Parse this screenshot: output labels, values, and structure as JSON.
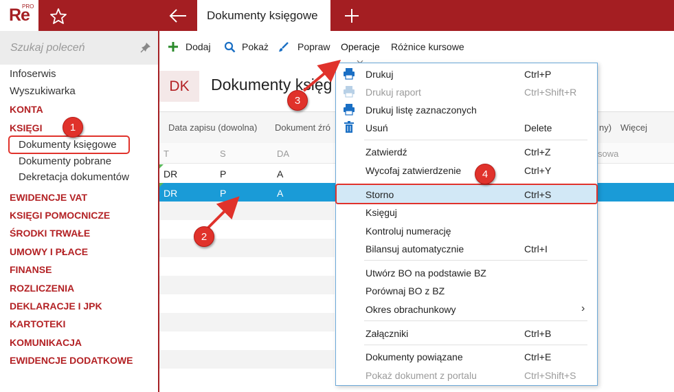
{
  "app": {
    "logo": "Re",
    "logo_sup": "PRO",
    "tab_title": "Dokumenty księgowe"
  },
  "sidebar": {
    "search_placeholder": "Szukaj poleceń",
    "items": [
      {
        "label": "Infoserwis"
      },
      {
        "label": "Wyszukiwarka"
      },
      {
        "label": "KONTA"
      },
      {
        "label": "KSIĘGI"
      },
      {
        "label": "Dokumenty księgowe"
      },
      {
        "label": "Dokumenty pobrane"
      },
      {
        "label": "Dekretacja dokumentów"
      },
      {
        "label": "EWIDENCJE VAT"
      },
      {
        "label": "KSIĘGI POMOCNICZE"
      },
      {
        "label": "ŚRODKI TRWAŁE"
      },
      {
        "label": "UMOWY I PŁACE"
      },
      {
        "label": "FINANSE"
      },
      {
        "label": "ROZLICZENIA"
      },
      {
        "label": "DEKLARACJE I JPK"
      },
      {
        "label": "KARTOTEKI"
      },
      {
        "label": "KOMUNIKACJA"
      },
      {
        "label": "EWIDENCJE DODATKOWE"
      }
    ]
  },
  "toolbar": {
    "add": "Dodaj",
    "show": "Pokaż",
    "edit": "Popraw",
    "operations": "Operacje",
    "rate_diff": "Różnice kursowe"
  },
  "view": {
    "badge": "DK",
    "title": "Dokumenty księg"
  },
  "filters": {
    "date": "Data zapisu (dowolna)",
    "source": "Dokument źró",
    "tail": "ny)",
    "more": "Więcej"
  },
  "columns": {
    "t": "T",
    "s": "S",
    "da": "DA",
    "tail": "sowa"
  },
  "rows": [
    {
      "t": "DR",
      "s": "P",
      "da": "A"
    },
    {
      "t": "DR",
      "s": "P",
      "da": "A"
    }
  ],
  "menu": {
    "items": [
      {
        "label": "Drukuj",
        "shortcut": "Ctrl+P"
      },
      {
        "label": "Drukuj raport",
        "shortcut": "Ctrl+Shift+R"
      },
      {
        "label": "Drukuj listę zaznaczonych",
        "shortcut": ""
      },
      {
        "label": "Usuń",
        "shortcut": "Delete"
      },
      {
        "label": "Zatwierdź",
        "shortcut": "Ctrl+Z"
      },
      {
        "label": "Wycofaj zatwierdzenie",
        "shortcut": "Ctrl+Y"
      },
      {
        "label": "Storno",
        "shortcut": "Ctrl+S"
      },
      {
        "label": "Księguj",
        "shortcut": ""
      },
      {
        "label": "Kontroluj numerację",
        "shortcut": ""
      },
      {
        "label": "Bilansuj automatycznie",
        "shortcut": "Ctrl+I"
      },
      {
        "label": "Utwórz BO na podstawie BZ",
        "shortcut": ""
      },
      {
        "label": "Porównaj BO z BZ",
        "shortcut": ""
      },
      {
        "label": "Okres obrachunkowy",
        "shortcut": "›"
      },
      {
        "label": "Załączniki",
        "shortcut": "Ctrl+B"
      },
      {
        "label": "Dokumenty powiązane",
        "shortcut": "Ctrl+E"
      },
      {
        "label": "Pokaż dokument z portalu",
        "shortcut": "Ctrl+Shift+S"
      }
    ]
  },
  "annotations": {
    "b1": "1",
    "b2": "2",
    "b3": "3",
    "b4": "4"
  },
  "colors": {
    "brand": "#a41e22",
    "selection": "#1a9bd7",
    "callout": "#e0322b",
    "menu_highlight": "#d2e8f6"
  }
}
